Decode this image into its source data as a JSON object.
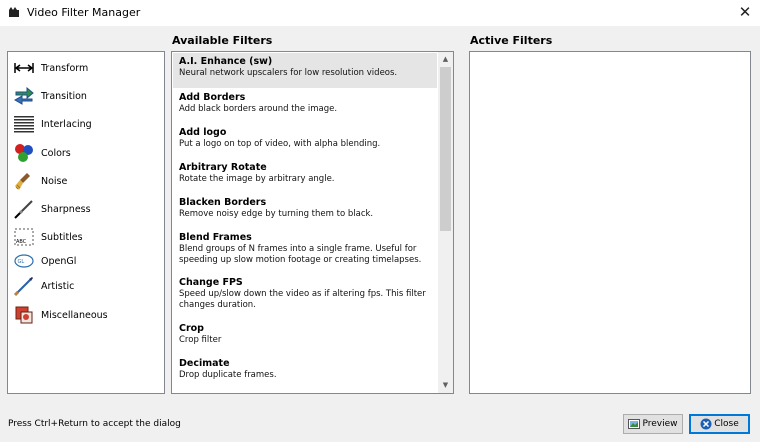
{
  "window": {
    "title": "Video Filter Manager",
    "close_glyph": "✕"
  },
  "categories": [
    {
      "label": "Transform",
      "icon": "transform-icon"
    },
    {
      "label": "Transition",
      "icon": "transition-icon"
    },
    {
      "label": "Interlacing",
      "icon": "interlacing-icon"
    },
    {
      "label": "Colors",
      "icon": "colors-icon"
    },
    {
      "label": "Noise",
      "icon": "noise-icon"
    },
    {
      "label": "Sharpness",
      "icon": "sharpness-icon"
    },
    {
      "label": "Subtitles",
      "icon": "subtitles-icon"
    },
    {
      "label": "OpenGl",
      "icon": "opengl-icon"
    },
    {
      "label": "Artistic",
      "icon": "artistic-icon"
    },
    {
      "label": "Miscellaneous",
      "icon": "miscellaneous-icon"
    }
  ],
  "available": {
    "title": "Available Filters",
    "items": [
      {
        "name": "A.I. Enhance (sw)",
        "desc": [
          "Neural network upscalers for low resolution videos."
        ],
        "selected": true
      },
      {
        "name": "Add Borders",
        "desc": [
          "Add black borders around the image."
        ]
      },
      {
        "name": "Add logo",
        "desc": [
          "Put a logo on top of video, with alpha blending."
        ]
      },
      {
        "name": "Arbitrary Rotate",
        "desc": [
          "Rotate the image by arbitrary angle."
        ]
      },
      {
        "name": "Blacken Borders",
        "desc": [
          "Remove noisy edge by turning them to black."
        ]
      },
      {
        "name": "Blend Frames",
        "desc": [
          "Blend groups of N frames into a single frame.  Useful for",
          "speeding up slow motion footage or creating timelapses."
        ]
      },
      {
        "name": "Change FPS",
        "desc": [
          "Speed up/slow down the video as if altering fps. This filter",
          "changes duration."
        ]
      },
      {
        "name": "Crop",
        "desc": [
          "Crop filter"
        ]
      },
      {
        "name": "Decimate",
        "desc": [
          "Drop duplicate frames."
        ]
      }
    ]
  },
  "active": {
    "title": "Active Filters"
  },
  "status_text": "Press Ctrl+Return to accept the dialog",
  "buttons": {
    "preview": "Preview",
    "close": "Close"
  },
  "scroll_glyphs": {
    "up": "▲",
    "down": "▼"
  }
}
